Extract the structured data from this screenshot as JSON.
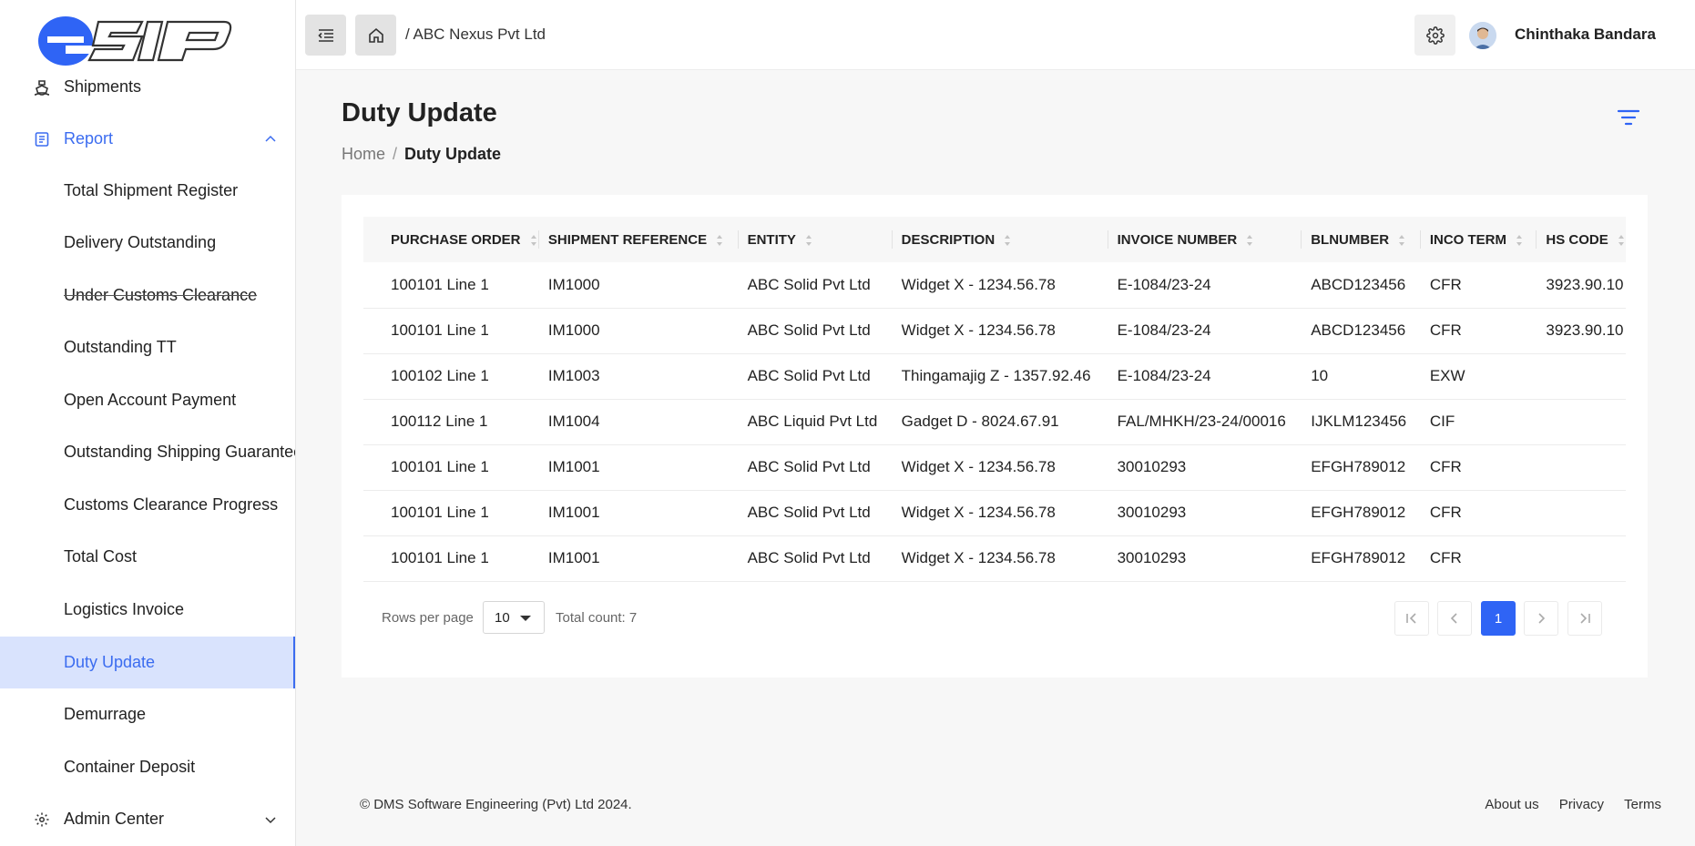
{
  "app": {
    "logo_text": "eSIP"
  },
  "sidebar": {
    "items": [
      {
        "label": "Shipments"
      },
      {
        "label": "Report"
      },
      {
        "label": "Total Shipment Register"
      },
      {
        "label": "Delivery Outstanding"
      },
      {
        "label": "Under Customs Clearance"
      },
      {
        "label": "Outstanding TT"
      },
      {
        "label": "Open Account Payment"
      },
      {
        "label": "Outstanding Shipping Guarantee"
      },
      {
        "label": "Customs Clearance Progress"
      },
      {
        "label": "Total Cost"
      },
      {
        "label": "Logistics Invoice"
      },
      {
        "label": "Duty Update"
      },
      {
        "label": "Demurrage"
      },
      {
        "label": "Container Deposit"
      },
      {
        "label": "Admin Center"
      }
    ]
  },
  "header": {
    "breadcrumb": "/ ABC Nexus Pvt Ltd",
    "user_name": "Chinthaka Bandara"
  },
  "page": {
    "title": "Duty Update",
    "breadcrumb_home": "Home",
    "breadcrumb_sep": "/",
    "breadcrumb_current": "Duty Update"
  },
  "table": {
    "columns": [
      "PURCHASE ORDER",
      "SHIPMENT REFERENCE",
      "ENTITY",
      "DESCRIPTION",
      "INVOICE NUMBER",
      "BLNUMBER",
      "INCO TERM",
      "HS CODE"
    ],
    "rows": [
      [
        "100101 Line 1",
        "IM1000",
        "ABC Solid Pvt Ltd",
        "Widget X - 1234.56.78",
        "E-1084/23-24",
        "ABCD123456",
        "CFR",
        "3923.90.10"
      ],
      [
        "100101 Line 1",
        "IM1000",
        "ABC Solid Pvt Ltd",
        "Widget X - 1234.56.78",
        "E-1084/23-24",
        "ABCD123456",
        "CFR",
        "3923.90.10"
      ],
      [
        "100102 Line 1",
        "IM1003",
        "ABC Solid Pvt Ltd",
        "Thingamajig Z - 1357.92.46",
        "E-1084/23-24",
        "10",
        "EXW",
        ""
      ],
      [
        "100112 Line 1",
        "IM1004",
        "ABC Liquid Pvt Ltd",
        "Gadget D - 8024.67.91",
        "FAL/MHKH/23-24/00016",
        "IJKLM123456",
        "CIF",
        ""
      ],
      [
        "100101 Line 1",
        "IM1001",
        "ABC Solid Pvt Ltd",
        "Widget X - 1234.56.78",
        "30010293",
        "EFGH789012",
        "CFR",
        ""
      ],
      [
        "100101 Line 1",
        "IM1001",
        "ABC Solid Pvt Ltd",
        "Widget X - 1234.56.78",
        "30010293",
        "EFGH789012",
        "CFR",
        ""
      ],
      [
        "100101 Line 1",
        "IM1001",
        "ABC Solid Pvt Ltd",
        "Widget X - 1234.56.78",
        "30010293",
        "EFGH789012",
        "CFR",
        ""
      ]
    ]
  },
  "pagination": {
    "rows_per_page_label": "Rows per page",
    "rows_per_page_value": "10",
    "total_count": "Total count: 7",
    "current_page": "1"
  },
  "footer": {
    "copyright": "© DMS Software Engineering (Pvt) Ltd 2024.",
    "about": "About us",
    "privacy": "Privacy",
    "terms": "Terms"
  },
  "colors": {
    "accent": "#2f64f5",
    "active_bg": "#d9e3fd"
  }
}
